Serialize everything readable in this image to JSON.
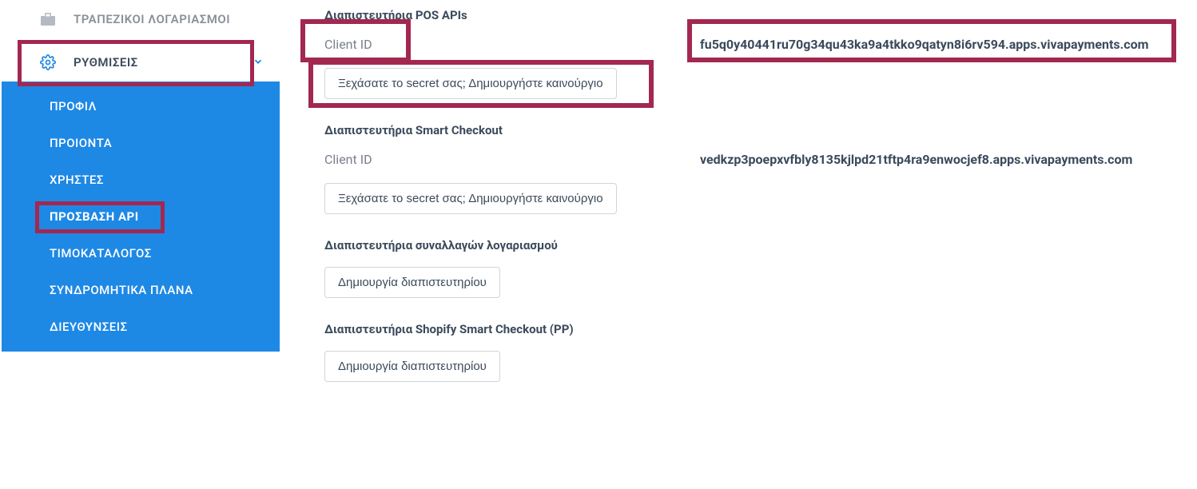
{
  "sidebar": {
    "bank_accounts": "ΤΡΑΠΕΖΙΚΟΙ ΛΟΓΑΡΙΑΣΜΟΙ",
    "settings": "ΡΥΘΜΙΣΕΙΣ",
    "sub": {
      "profile": "ΠΡΟΦΙΛ",
      "products": "ΠΡΟΙΟΝΤΑ",
      "users": "ΧΡΗΣΤΕΣ",
      "api_access": "ΠΡΟΣΒΑΣΗ API",
      "pricing": "ΤΙΜΟΚΑΤΑΛΟΓΟΣ",
      "plans": "ΣΥΝΔΡΟΜΗΤΙΚΑ ΠΛΑΝΑ",
      "addresses": "ΔΙΕΥΘΥΝΣΕΙΣ"
    }
  },
  "main": {
    "pos": {
      "title": "Διαπιστευτήρια POS APIs",
      "client_id_label": "Client ID",
      "client_id_value": "fu5q0y40441ru70g34qu43ka9a4tkko9qatyn8i6rv594.apps.vivapayments.com",
      "regen_btn": "Ξεχάσατε το secret σας; Δημιουργήστε καινούργιο"
    },
    "smart": {
      "title": "Διαπιστευτήρια Smart Checkout",
      "client_id_label": "Client ID",
      "client_id_value": "vedkzp3poepxvfbly8135kjlpd21tftp4ra9enwocjef8.apps.vivapayments.com",
      "regen_btn": "Ξεχάσατε το secret σας; Δημιουργήστε καινούργιο"
    },
    "txn": {
      "title": "Διαπιστευτήρια συναλλαγών λογαριασμού",
      "create_btn": "Δημιουργία διαπιστευτηρίου"
    },
    "shopify": {
      "title": "Διαπιστευτήρια Shopify Smart Checkout (PP)",
      "create_btn": "Δημιουργία διαπιστευτηρίου"
    }
  }
}
